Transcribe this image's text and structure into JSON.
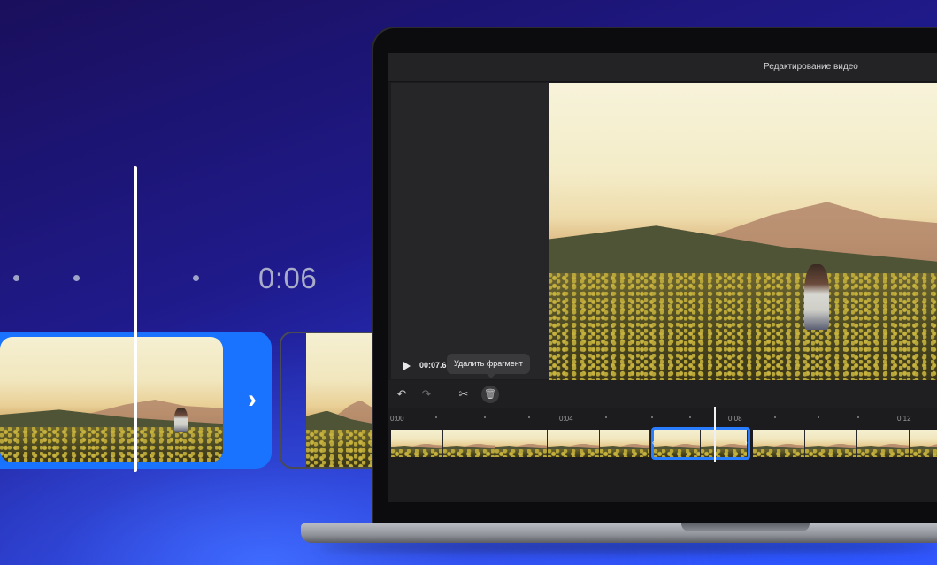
{
  "zoom_detail": {
    "time_label": "0:06"
  },
  "window": {
    "title": "Редактирование видео"
  },
  "player": {
    "timecode": "00:07.6",
    "tooltip": "Удалить фрагмент"
  },
  "toolbar": {
    "undo_icon": "undo-icon",
    "redo_icon": "redo-icon",
    "split_icon": "scissors-icon",
    "delete_icon": "trash-icon"
  },
  "timeline": {
    "ticks": [
      "0:00",
      "0:04",
      "0:08",
      "0:12"
    ]
  },
  "colors": {
    "accent": "#2a7dff",
    "background": "#1c1c1e"
  }
}
